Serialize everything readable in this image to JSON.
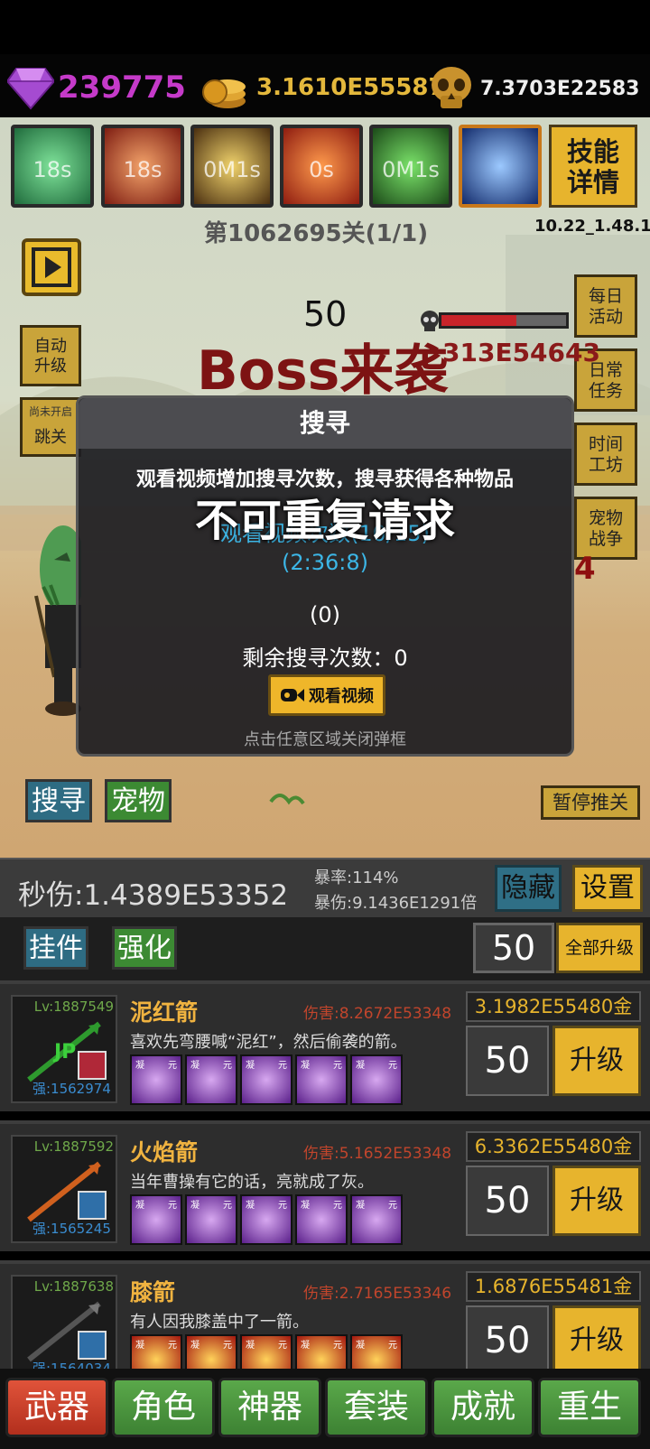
{
  "resources": {
    "gems": "239775",
    "gold": "3.1610E55587",
    "skulls": "7.3703E22583"
  },
  "skills": [
    {
      "label": "18s",
      "color": "#2f9a5e"
    },
    {
      "label": "18s",
      "color": "#b23a22"
    },
    {
      "label": "0M1s",
      "color": "#7a5c1c"
    },
    {
      "label": "0s",
      "color": "#c24a1a"
    },
    {
      "label": "0M1s",
      "color": "#2c7a2c"
    },
    {
      "label": "",
      "color": "#1d3f88"
    }
  ],
  "skill_detail_label": "技能\n详情",
  "stage": "第1062695关(1/1)",
  "version": "10.22_1.48.1",
  "left_buttons": {
    "auto_upgrade": "自动\n升级",
    "skip_hint": "尚未开启",
    "skip": "跳关"
  },
  "right_buttons": [
    "每日\n活动",
    "日常\n任务",
    "时间\n工坊",
    "宠物\n战争"
  ],
  "boss": {
    "count": "50",
    "banner": "Boss来袭",
    "hp": "313E54643"
  },
  "popup": {
    "title": "搜寻",
    "desc": "观看视频增加搜寻次数，搜寻获得各种物品",
    "toast": "不可重复请求",
    "video_count": "观看视频次数(10/15)",
    "timer": "(2:36:8)",
    "zero": "(0)",
    "remaining": "剩余搜寻次数：0",
    "watch_btn": "观看视频",
    "close_hint": "点击任意区域关闭弹框"
  },
  "scene_buttons": {
    "search": "搜寻",
    "pet": "宠物",
    "pause": "暂停推关"
  },
  "stats": {
    "dps": "秒伤:1.4389E53352",
    "crit_rate": "暴率:114%",
    "crit_dmg": "暴伤:9.1436E1291倍",
    "hide": "隐藏",
    "settings": "设置"
  },
  "tabs": {
    "pendant": "挂件",
    "enhance": "强化",
    "count": "50",
    "upgrade_all": "全部升级"
  },
  "items": [
    {
      "lv": "Lv:1887549",
      "name": "泥红箭",
      "dmg": "伤害:8.2672E53348",
      "desc": "喜欢先弯腰喊“泥红”，然后偷袭的箭。",
      "str": "强:1562974",
      "cost": "3.1982E55480金",
      "lvl": "50",
      "up": "升级",
      "arrow_color": "#2e9a2e",
      "gem_type": "yinyang"
    },
    {
      "lv": "Lv:1887592",
      "name": "火焰箭",
      "dmg": "伤害:5.1652E53348",
      "desc": "当年曹操有它的话，亮就成了灰。",
      "str": "强:1565245",
      "cost": "6.3362E55480金",
      "lvl": "50",
      "up": "升级",
      "arrow_color": "#d0601e",
      "gem_type": "yinyang"
    },
    {
      "lv": "Lv:1887638",
      "name": "膝箭",
      "dmg": "伤害:2.7165E53346",
      "desc": "有人因我膝盖中了一箭。",
      "str": "强:1564034",
      "cost": "1.6876E55481金",
      "lvl": "50",
      "up": "升级",
      "arrow_color": "#444",
      "gem_type": "fire"
    }
  ],
  "gem_tags": [
    "凝",
    "元"
  ],
  "nav": [
    {
      "label": "武器",
      "active": true
    },
    {
      "label": "角色",
      "active": false
    },
    {
      "label": "神器",
      "active": false
    },
    {
      "label": "套装",
      "active": false
    },
    {
      "label": "成就",
      "active": false
    },
    {
      "label": "重生",
      "active": false
    }
  ]
}
